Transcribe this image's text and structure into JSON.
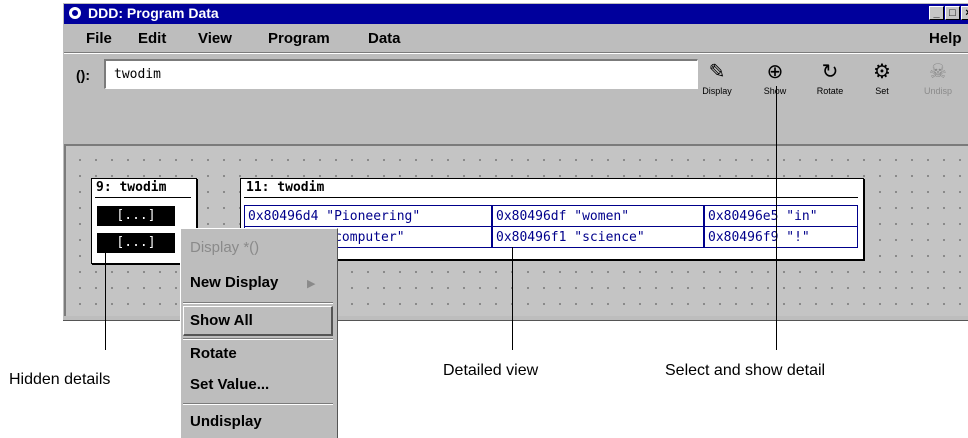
{
  "window": {
    "title": "DDD: Program Data",
    "controls": {
      "minimize": "_",
      "maximize": "□",
      "close": "×"
    }
  },
  "menubar": {
    "items": [
      {
        "label": "File"
      },
      {
        "label": "Edit"
      },
      {
        "label": "View"
      },
      {
        "label": "Program"
      },
      {
        "label": "Data"
      },
      {
        "label": "Help"
      }
    ]
  },
  "toolbar": {
    "arg_label": "():",
    "arg_value": "twodim",
    "buttons": [
      {
        "label": "Display",
        "icon": "display-icon",
        "enabled": true
      },
      {
        "label": "Show",
        "icon": "magnifier-icon",
        "enabled": true
      },
      {
        "label": "Rotate",
        "icon": "rotate-icon",
        "enabled": true
      },
      {
        "label": "Set",
        "icon": "set-icon",
        "enabled": true
      },
      {
        "label": "Undisp",
        "icon": "undisplay-icon",
        "enabled": false
      }
    ]
  },
  "displays": {
    "d9": {
      "title": "9: twodim",
      "rows": [
        "[...]",
        "[...]"
      ]
    },
    "d11": {
      "title": "11: twodim",
      "rows": [
        [
          "0x80496d4 \"Pioneering\"",
          "0x80496df \"women\"",
          "0x80496e5 \"in\""
        ],
        [
          "0x80496e8 \"computer\"",
          "0x80496f1 \"science\"",
          "0x80496f9 \"!\""
        ]
      ]
    }
  },
  "popup_menu": {
    "items": [
      {
        "label": "Display *()",
        "enabled": false
      },
      {
        "label": "New Display",
        "enabled": true,
        "submenu": "▶"
      },
      {
        "label": "Show All",
        "enabled": true,
        "active": true
      },
      {
        "label": "Rotate",
        "enabled": true
      },
      {
        "label": "Set Value...",
        "enabled": true
      },
      {
        "label": "Undisplay",
        "enabled": true
      }
    ]
  },
  "annotations": {
    "hidden": "Hidden details",
    "detailed": "Detailed view",
    "select": "Select and show detail"
  },
  "colors": {
    "titlebar": "#00009c",
    "chrome": "#bdbdbd",
    "data_cell": "#00008b"
  }
}
